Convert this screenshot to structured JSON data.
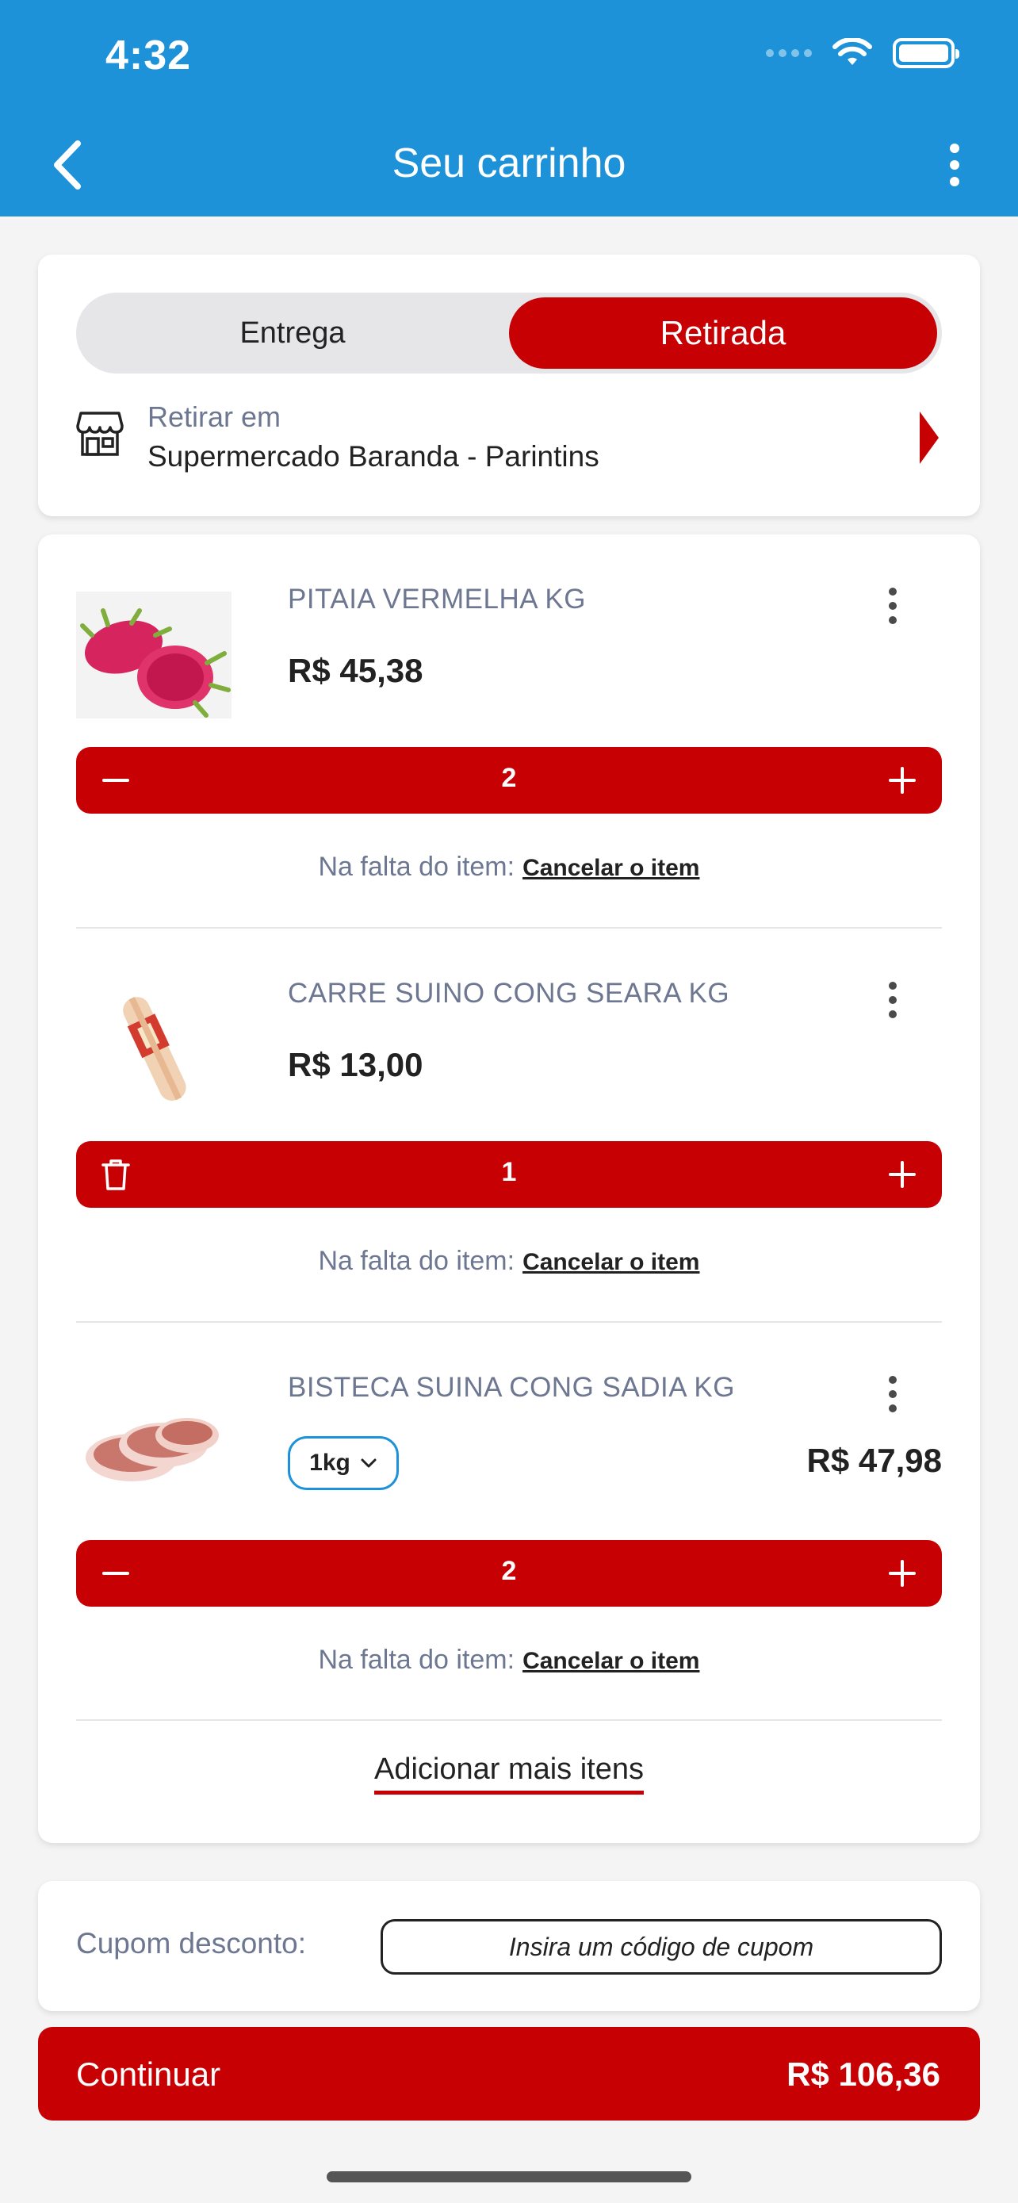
{
  "status_bar": {
    "time": "4:32"
  },
  "nav": {
    "title": "Seu carrinho"
  },
  "delivery": {
    "option_delivery": "Entrega",
    "option_pickup": "Retirada",
    "selected": "Retirada",
    "pickup_label": "Retirar em",
    "pickup_store": "Supermercado Baranda - Parintins"
  },
  "items": [
    {
      "name": "PITAIA VERMELHA KG",
      "price": "R$ 45,38",
      "quantity": "2",
      "left_action": "minus-icon",
      "shortage_label": "Na falta do item:",
      "shortage_action": "Cancelar o item"
    },
    {
      "name": "CARRE SUINO CONG SEARA KG",
      "price": "R$ 13,00",
      "quantity": "1",
      "left_action": "trash-icon",
      "shortage_label": "Na falta do item:",
      "shortage_action": "Cancelar o item"
    },
    {
      "name": "BISTECA SUINA CONG SADIA KG",
      "price": "R$ 47,98",
      "unit": "1kg",
      "quantity": "2",
      "left_action": "minus-icon",
      "shortage_label": "Na falta do item:",
      "shortage_action": "Cancelar o item"
    }
  ],
  "add_more": "Adicionar mais itens",
  "coupon": {
    "label": "Cupom desconto:",
    "placeholder": "Insira um código de cupom"
  },
  "footer": {
    "continue_label": "Continuar",
    "total": "R$ 106,36"
  },
  "colors": {
    "header_blue": "#1d92d9",
    "accent_red": "#c70003",
    "muted_text": "#6d7791"
  }
}
